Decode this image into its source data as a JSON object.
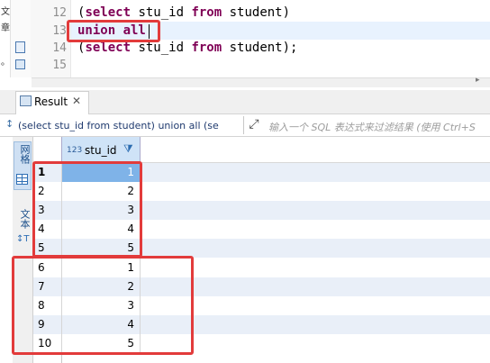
{
  "editor": {
    "lines": [
      {
        "num": "12",
        "kw1": "select",
        "t1": " stu_id ",
        "kw2": "from",
        "t2": " student)",
        "pre": "("
      },
      {
        "num": "13",
        "text": "union all"
      },
      {
        "num": "14",
        "kw1": "select",
        "t1": " stu_id ",
        "kw2": "from",
        "t2": " student);",
        "pre": "("
      },
      {
        "num": "15"
      }
    ],
    "left_strip_chars": [
      "文",
      "章",
      "。"
    ]
  },
  "result_tab": {
    "label": "Result",
    "close": "✕"
  },
  "filter": {
    "query": "(select stu_id from student) union all (se",
    "placeholder": "输入一个 SQL 表达式来过滤结果 (使用 Ctrl+S"
  },
  "side_tabs": {
    "grid": "网格",
    "text": "文本"
  },
  "grid": {
    "column": {
      "type": "123",
      "name": "stu_id"
    },
    "rows": [
      {
        "n": "1",
        "v": "1"
      },
      {
        "n": "2",
        "v": "2"
      },
      {
        "n": "3",
        "v": "3"
      },
      {
        "n": "4",
        "v": "4"
      },
      {
        "n": "5",
        "v": "5"
      },
      {
        "n": "6",
        "v": "1"
      },
      {
        "n": "7",
        "v": "2"
      },
      {
        "n": "8",
        "v": "3"
      },
      {
        "n": "9",
        "v": "4"
      },
      {
        "n": "10",
        "v": "5"
      }
    ]
  },
  "colors": {
    "highlight": "#e23b3b",
    "keyword": "#7f0055",
    "selection": "#7fb3e8"
  }
}
